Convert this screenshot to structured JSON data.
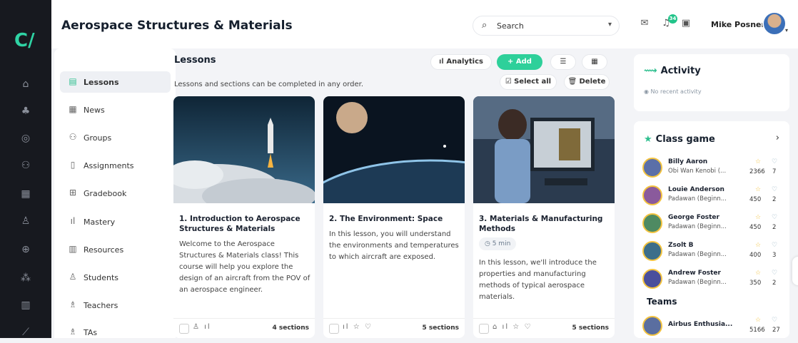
{
  "app": {
    "course_title": "Aerospace Structures & Materials"
  },
  "rail": {
    "icons": [
      "logo-icon",
      "home-icon",
      "courses-icon",
      "calendar-icon",
      "groups-icon",
      "apps-icon",
      "profile-icon",
      "settings-icon",
      "network-icon",
      "library-icon",
      "chart-icon"
    ]
  },
  "header": {
    "search_label": "Search",
    "notification_count": "34",
    "user_name": "Mike Posner"
  },
  "sidebar": {
    "items": [
      {
        "label": "Lessons",
        "icon": "book-icon",
        "active": true
      },
      {
        "label": "News",
        "icon": "newspaper-icon"
      },
      {
        "label": "Groups",
        "icon": "groups-icon"
      },
      {
        "label": "Assignments",
        "icon": "clipboard-icon"
      },
      {
        "label": "Gradebook",
        "icon": "gradebook-icon"
      },
      {
        "label": "Mastery",
        "icon": "mastery-icon"
      },
      {
        "label": "Resources",
        "icon": "resources-icon"
      },
      {
        "label": "Students",
        "icon": "student-icon"
      },
      {
        "label": "Teachers",
        "icon": "teacher-icon"
      },
      {
        "label": "TAs",
        "icon": "ta-icon"
      }
    ]
  },
  "main": {
    "title": "Lessons",
    "subtitle": "Lessons and sections can be completed in any order.",
    "buttons": {
      "analytics": "Analytics",
      "add": "+ Add",
      "select_all": "Select all",
      "delete": "Delete"
    },
    "cards": [
      {
        "title": "1. Introduction to Aerospace Structures & Materials",
        "description": "Welcome to the Aerospace Structures & Materials class! This course will help you explore the design of an aircraft from the POV of an aerospace engineer.",
        "sections": "4 sections"
      },
      {
        "title": "2. The Environment: Space",
        "description": "In this lesson, you will understand the environments and temperatures to which aircraft are exposed.",
        "sections": "5 sections"
      },
      {
        "title": "3. Materials & Manufacturing Methods",
        "duration": "5 min",
        "description": "In this lesson, we'll introduce the properties and manufacturing methods of typical aerospace materials.",
        "sections": "5 sections"
      }
    ]
  },
  "activity": {
    "title": "Activity",
    "empty_text": "No recent activity"
  },
  "class_game": {
    "title": "Class game",
    "players": [
      {
        "name": "Billy Aaron",
        "subtitle": "Obi Wan Kenobi (...",
        "score": "2366",
        "value": "7"
      },
      {
        "name": "Louie Anderson",
        "subtitle": "Padawan (Beginn...",
        "score": "450",
        "value": "2"
      },
      {
        "name": "George Foster",
        "subtitle": "Padawan (Beginn...",
        "score": "450",
        "value": "2"
      },
      {
        "name": "Zsolt B",
        "subtitle": "Padawan (Beginn...",
        "score": "400",
        "value": "3"
      },
      {
        "name": "Andrew Foster",
        "subtitle": "Padawan (Beginn...",
        "score": "350",
        "value": "2"
      }
    ],
    "teams_title": "Teams",
    "teams": [
      {
        "name": "Airbus Enthusia...",
        "score": "5166",
        "value": "27"
      }
    ]
  },
  "colors": {
    "accent": "#2ed09a",
    "rail": "#17191f",
    "star": "#f3c340"
  }
}
